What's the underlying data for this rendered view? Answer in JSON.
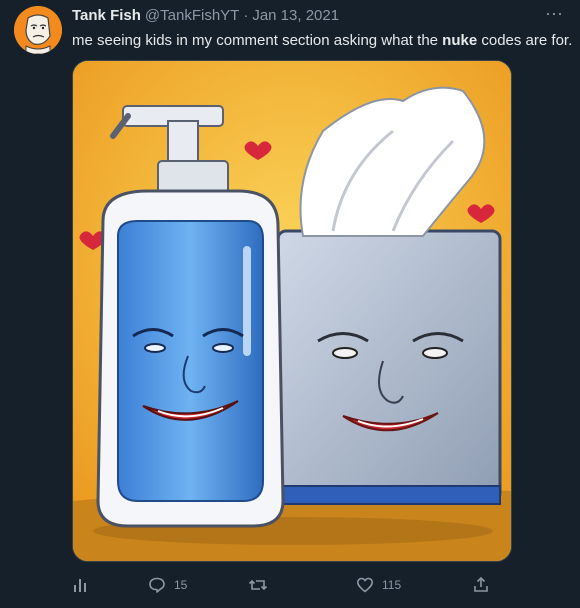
{
  "tweet": {
    "display_name": "Tank Fish",
    "handle": "@TankFishYT",
    "separator": "·",
    "date": "Jan 13, 2021",
    "more_glyph": "···",
    "text_before": "me seeing kids in my comment section asking what the ",
    "text_bold": "nuke",
    "text_after": " codes are for."
  },
  "actions": {
    "analytics_icon": "bar-chart-icon",
    "reply_icon": "speech-bubble-icon",
    "reply_count": "15",
    "retweet_icon": "retweet-arrows-icon",
    "like_icon": "heart-icon",
    "like_count": "115",
    "share_icon": "share-upload-icon"
  },
  "colors": {
    "background": "#15202b",
    "text_primary": "#e7e9ea",
    "text_secondary": "#8b98a5",
    "avatar_bg": "#f28a1e",
    "image_bg": "#f4b62b"
  }
}
